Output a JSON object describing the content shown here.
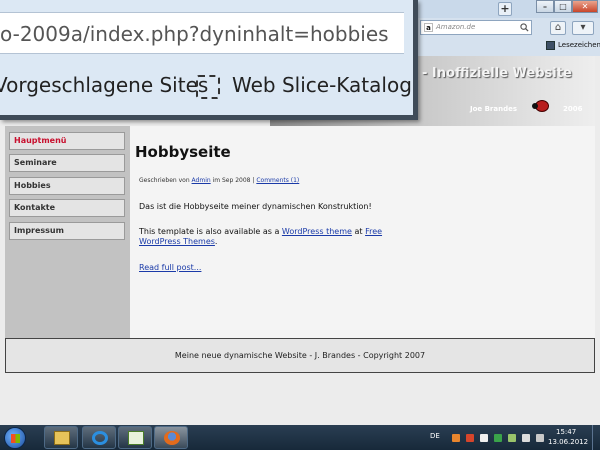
{
  "browser": {
    "search": {
      "placeholder": "Amazon.de",
      "engine_icon": "a"
    },
    "new_tab_label": "+",
    "window_buttons": [
      "–",
      "□",
      "✕"
    ],
    "bookmarks_bar": {
      "item": "Lesezeichen"
    }
  },
  "magnifier": {
    "url": "o-2009a/index.php?dyninhalt=hobbies",
    "bookmark_1": "Vorgeschlagene Sites",
    "bookmark_2": "Web Slice-Katalog"
  },
  "site": {
    "header": {
      "title": "- Inoffizielle Website",
      "author": "Joe Brandes",
      "year": "2006"
    },
    "menu": [
      {
        "label": "Hauptmenü",
        "active": true
      },
      {
        "label": "Seminare",
        "active": false
      },
      {
        "label": "Hobbies",
        "active": false
      },
      {
        "label": "Kontakte",
        "active": false
      },
      {
        "label": "Impressum",
        "active": false
      }
    ],
    "post": {
      "title": "Hobbyseite",
      "meta_prefix": "Geschrieben von ",
      "meta_author": "Admin",
      "meta_date": " im Sep 2008 ",
      "meta_sep": "|",
      "meta_comments": "Comments (1)",
      "paragraph_1": "Das ist die Hobbyseite meiner dynamischen Konstruktion!",
      "paragraph_2_prefix": "This template is also available as a ",
      "paragraph_2_link1": "WordPress theme",
      "paragraph_2_mid": " at ",
      "paragraph_2_link2": "Free WordPress Themes",
      "paragraph_2_suffix": ".",
      "read_more": "Read full post..."
    },
    "footer": "Meine neue dynamische Website - J. Brandes - Copyright 2007"
  },
  "taskbar": {
    "apps": [
      "folder-icon",
      "internet-explorer-icon",
      "notepad-icon",
      "firefox-icon"
    ],
    "language": "DE",
    "clock_time": "15:47",
    "clock_date": "13.06.2012"
  }
}
